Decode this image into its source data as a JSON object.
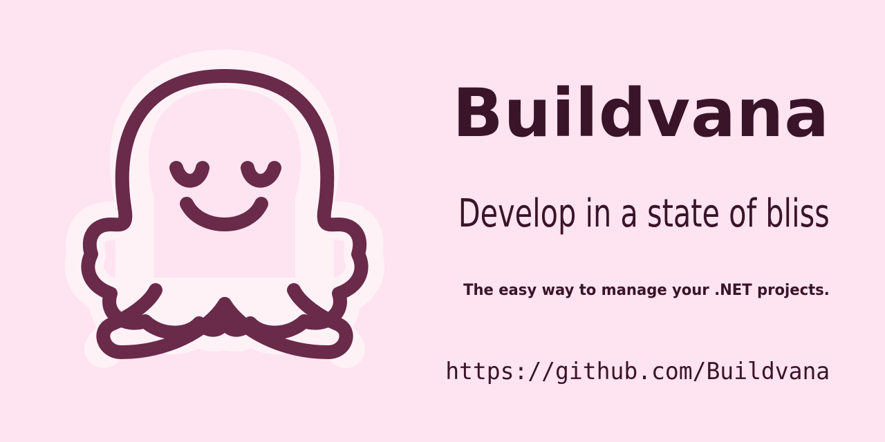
{
  "brand": {
    "name": "Buildvana",
    "tagline": "Develop in a state of bliss",
    "description": "The easy way to manage your .NET projects.",
    "url": "https://github.com/Buildvana"
  },
  "mascot": {
    "icon": "octopus-icon"
  },
  "colors": {
    "background": "#fde4f0",
    "outline": "#6a2a4a",
    "halo": "#fff2f7",
    "text": "#3a1428"
  }
}
